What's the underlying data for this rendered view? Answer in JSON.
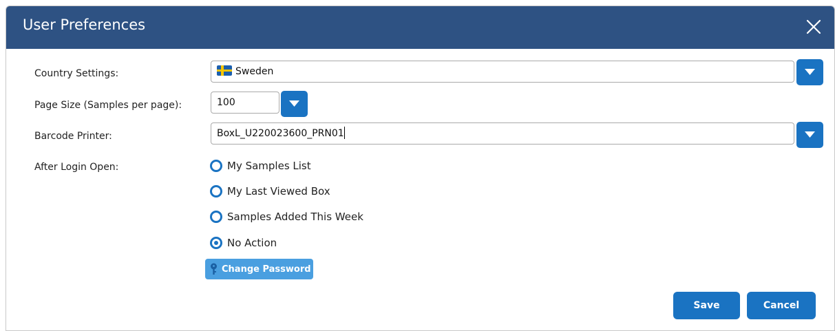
{
  "dialog": {
    "title": "User Preferences",
    "close_icon": "close-icon"
  },
  "country": {
    "label": "Country Settings:",
    "value": "Sweden",
    "flag_icon": "sweden-flag-icon",
    "flag_colors": {
      "blue": "#1c5fae",
      "yellow": "#f7c600"
    }
  },
  "page_size": {
    "label": "Page Size (Samples per page):",
    "value": "100"
  },
  "printer": {
    "label": "Barcode Printer:",
    "value": "BoxL_U220023600_PRN01"
  },
  "after_login": {
    "label": "After Login Open:",
    "options": [
      {
        "label": "My Samples List",
        "checked": false
      },
      {
        "label": "My Last Viewed Box",
        "checked": false
      },
      {
        "label": "Samples Added This Week",
        "checked": false
      },
      {
        "label": "No Action",
        "checked": true
      }
    ]
  },
  "change_password": {
    "label": "Change Password",
    "icon": "key-icon"
  },
  "footer": {
    "save_label": "Save",
    "cancel_label": "Cancel"
  },
  "colors": {
    "titlebar": "#2e5283",
    "primary": "#1a73c2",
    "secondary_button": "#4a9fe0"
  }
}
